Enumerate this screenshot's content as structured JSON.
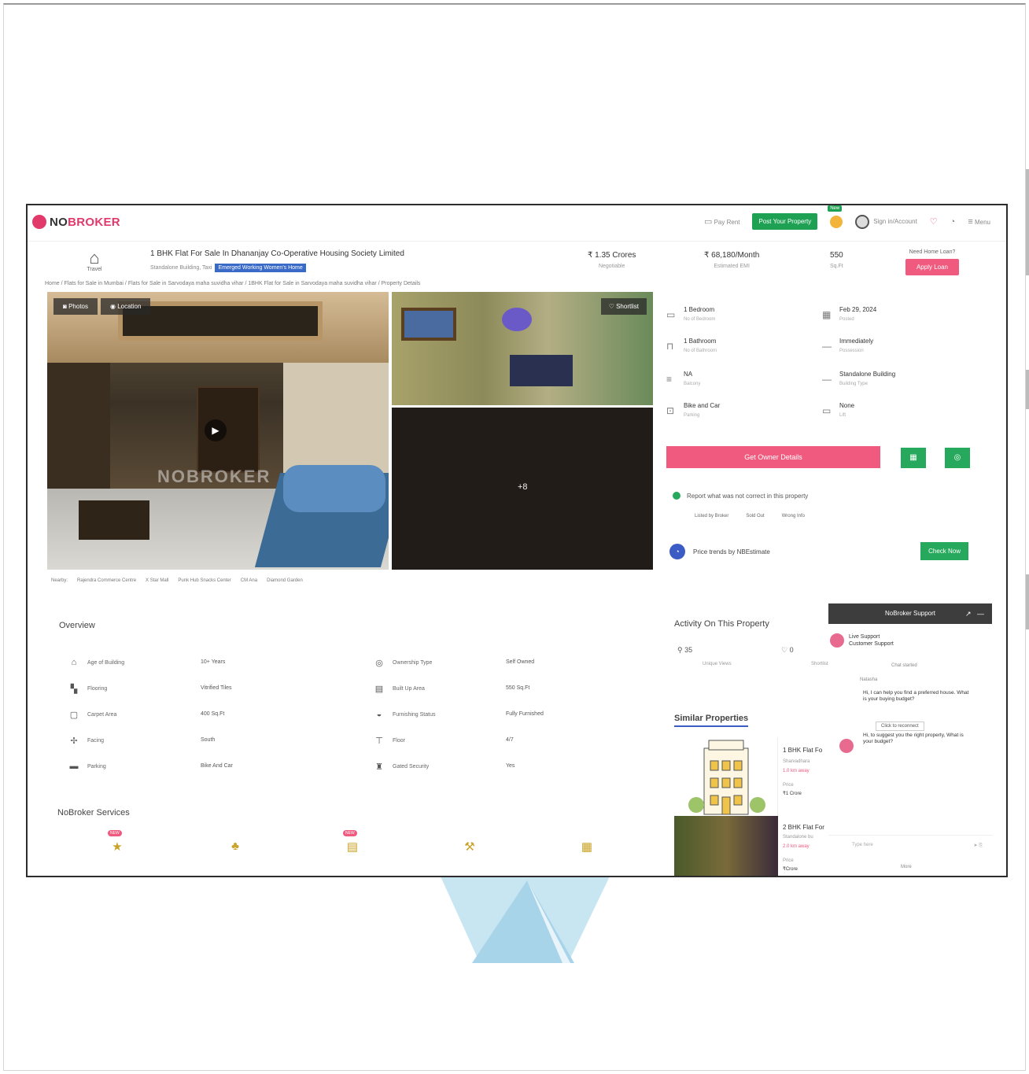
{
  "header": {
    "logo": "NOBROKER",
    "logo_head": "NO",
    "logo_tail": "BROKER",
    "pay_rent": "Pay Rent",
    "post_property": "Post Your Property",
    "new_badge": "New",
    "user": "Sign in/Account",
    "menu": "Menu"
  },
  "property": {
    "icon_label": "Travel",
    "title": "1 BHK Flat For Sale In Dhananjay Co-Operative Housing Society Limited",
    "subtitle": "Standalone Building, Taxi",
    "highlight": "Emerged Working Women's Home",
    "price": "₹ 1.35 Crores",
    "price_label": "Negotiable",
    "emi": "₹ 68,180/Month",
    "emi_label": "Estimated EMI",
    "area": "550",
    "area_label": "Sq.Ft",
    "loan_hint": "Need Home Loan?",
    "apply_loan": "Apply Loan",
    "breadcrumb": "Home / Flats for Sale in Mumbai / Flats for Sale in Sarvodaya maha suvidha vihar / 1BHK Flat for Sale in Sarvodaya maha suvidha vihar / Property Details"
  },
  "gallery": {
    "photos_tab": "Photos",
    "location_tab": "Location",
    "watermark": "NOBROKER",
    "shortlist": "Shortlist",
    "more": "+8"
  },
  "nearby": [
    "Nearby:",
    "Rajendra Commerce Centre",
    "X Star Mall",
    "Punk Hub Snacks Center",
    "CM Ana",
    "Diamond Garden"
  ],
  "details": [
    {
      "icon": "bed-icon",
      "glyph": "▭",
      "value": "1 Bedroom",
      "label": "No of Bedroom"
    },
    {
      "icon": "calendar-icon",
      "glyph": "▦",
      "value": "Feb 29, 2024",
      "label": "Posted"
    },
    {
      "icon": "bath-icon",
      "glyph": "⊓",
      "value": "1 Bathroom",
      "label": "No of Bathroom"
    },
    {
      "icon": "possession-icon",
      "glyph": "—",
      "value": "Immediately",
      "label": "Possession"
    },
    {
      "icon": "balcony-icon",
      "glyph": "≡",
      "value": "NA",
      "label": "Balcony"
    },
    {
      "icon": "building-icon",
      "glyph": "—",
      "value": "Standalone Building",
      "label": "Building Type"
    },
    {
      "icon": "parking-icon",
      "glyph": "⊡",
      "value": "Bike and Car",
      "label": "Parking"
    },
    {
      "icon": "lift-icon",
      "glyph": "▭",
      "value": "None",
      "label": "Lift"
    }
  ],
  "actions": {
    "owner_details": "Get Owner Details"
  },
  "report": {
    "text": "Report what was not correct in this property",
    "tags": [
      "Listed by Broker",
      "Sold Out",
      "Wrong Info"
    ]
  },
  "estimate": {
    "text": "Price trends by NBEstimate",
    "button": "Check Now"
  },
  "overview": {
    "title": "Overview",
    "items": [
      {
        "icon": "age-icon",
        "glyph": "⌂",
        "label": "Age of Building",
        "value": "10+ Years"
      },
      {
        "icon": "ownership-icon",
        "glyph": "◎",
        "label": "Ownership Type",
        "value": "Self Owned"
      },
      {
        "icon": "flooring-icon",
        "glyph": "▚",
        "label": "Flooring",
        "value": "Vitrified Tiles"
      },
      {
        "icon": "built-up-icon",
        "glyph": "▤",
        "label": "Built Up Area",
        "value": "550 Sq.Ft"
      },
      {
        "icon": "carpet-icon",
        "glyph": "▢",
        "label": "Carpet Area",
        "value": "400 Sq.Ft"
      },
      {
        "icon": "furnishing-icon",
        "glyph": "◒",
        "label": "Furnishing Status",
        "value": "Fully Furnished"
      },
      {
        "icon": "facing-icon",
        "glyph": "✢",
        "label": "Facing",
        "value": "South"
      },
      {
        "icon": "floor-icon",
        "glyph": "⊤",
        "label": "Floor",
        "value": "4/7"
      },
      {
        "icon": "car-icon",
        "glyph": "▬",
        "label": "Parking",
        "value": "Bike And Car"
      },
      {
        "icon": "security-icon",
        "glyph": "♜",
        "label": "Gated Security",
        "value": "Yes"
      }
    ]
  },
  "services": {
    "title": "NoBroker Services",
    "items": [
      {
        "icon": "star-service-icon",
        "glyph": "★",
        "badge": "NEW"
      },
      {
        "icon": "painting-service-icon",
        "glyph": "♣",
        "badge": ""
      },
      {
        "icon": "rental-service-icon",
        "glyph": "▤",
        "badge": "NEW"
      },
      {
        "icon": "legal-service-icon",
        "glyph": "⚒",
        "badge": ""
      },
      {
        "icon": "document-service-icon",
        "glyph": "▦",
        "badge": ""
      }
    ]
  },
  "activity": {
    "title": "Activity On This Property",
    "views": "35",
    "views_label": "Unique Views",
    "shortlists": "0",
    "shortlists_label": "Shortlists"
  },
  "similar": {
    "title": "Similar Properties",
    "cards": [
      {
        "title": "1 BHK Flat Fo",
        "location": "Sharvadhara",
        "distance": "1.0 km away",
        "price_label": "Price",
        "price": "₹1 Crore"
      },
      {
        "title": "2 BHK Flat For",
        "location": "Standalone bu",
        "distance": "2.0 km away",
        "price_label": "Price",
        "price": "₹Crore"
      }
    ]
  },
  "chat": {
    "header": "NoBroker Support",
    "agent": "Live Support",
    "agent_sub": "Customer Support",
    "chat_started": "Chat started",
    "agent_name": "Natasha",
    "message1": "Hi, I can help you find a preferred house. What is your buying budget?",
    "reconnect": "Click to reconnect",
    "message2": "Hi, to suggest you the right property, What is your budget?",
    "input_placeholder": "Type here",
    "more": "More"
  }
}
